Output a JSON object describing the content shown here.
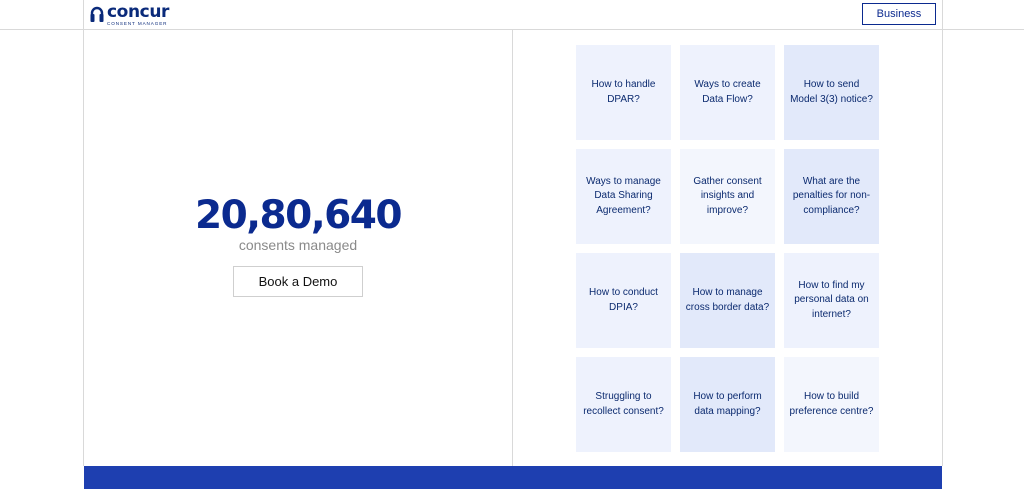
{
  "header": {
    "logo_word": "concur",
    "logo_subtitle": "CONSENT MANAGER",
    "business_label": "Business"
  },
  "hero": {
    "counter": "20,80,640",
    "counter_label": "consents managed",
    "demo_label": "Book a Demo"
  },
  "tiles": [
    "How to handle DPAR?",
    "Ways to create Data Flow?",
    "How to send Model 3(3) notice?",
    "Ways to manage Data Sharing Agreement?",
    "Gather consent insights and improve?",
    "What are the penalties for non-compliance?",
    "How to conduct DPIA?",
    "How to manage cross border data?",
    "How to find my personal data on internet?",
    "Struggling to recollect consent?",
    "How to perform data mapping?",
    "How to build preference centre?"
  ],
  "colors": {
    "brand": "#0b2a8f",
    "tile_light": "#eef2fd",
    "tile_dark": "#e2e9fa",
    "footer": "#1e3fb0"
  },
  "icons": {
    "logo": "headphone-lock-icon"
  }
}
